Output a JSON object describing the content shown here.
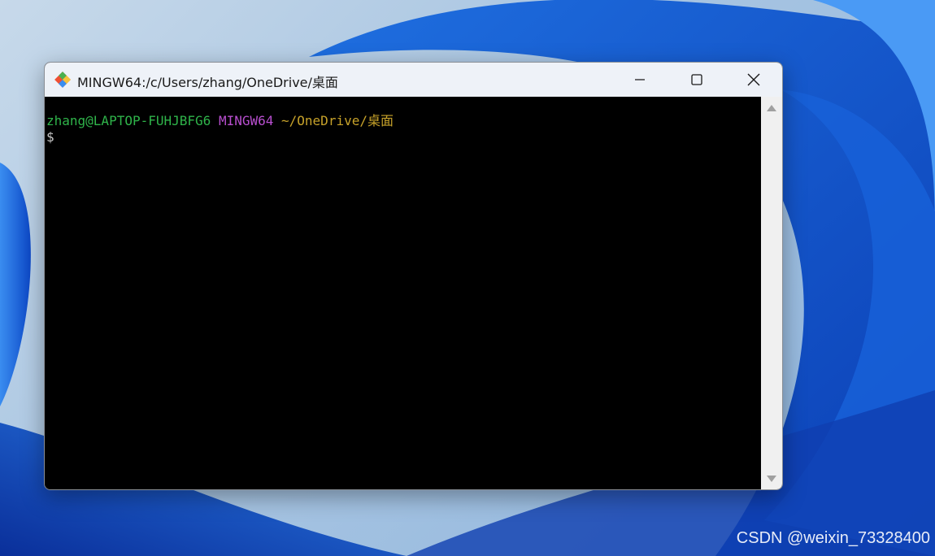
{
  "window": {
    "title": "MINGW64:/c/Users/zhang/OneDrive/桌面",
    "app_icon": "git-bash-icon",
    "buttons": {
      "minimize": "minimize-icon",
      "maximize": "maximize-icon",
      "close": "close-icon"
    }
  },
  "terminal": {
    "prompt": {
      "user_host": "zhang@LAPTOP-FUHJBFG6",
      "env": "MINGW64",
      "path": "~/OneDrive/桌面"
    },
    "input_line": "$"
  },
  "colors": {
    "user_host": "#2fb44a",
    "env": "#b84fcf",
    "path": "#c7a22a",
    "terminal_bg": "#000000",
    "titlebar_bg": "#eef2f8"
  },
  "watermark": "CSDN @weixin_73328400"
}
